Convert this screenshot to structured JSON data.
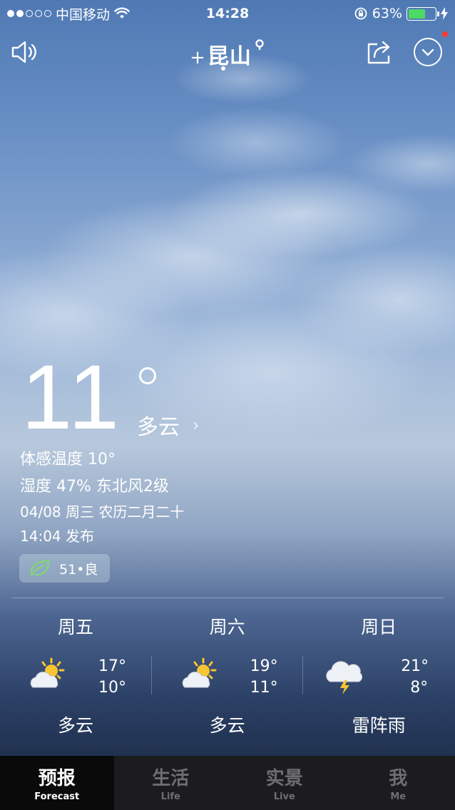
{
  "status_bar": {
    "carrier": "中国移动",
    "time": "14:28",
    "battery_percent": "63%",
    "battery_level": 0.63,
    "signal_bars_filled": 2,
    "signal_bars_total": 5
  },
  "nav": {
    "city": "昆山",
    "add_symbol": "+"
  },
  "current": {
    "temperature": "11",
    "condition": "多云",
    "feels_like": "体感温度 10°",
    "humidity_wind": "湿度 47% 东北风2级",
    "date_line": "04/08 周三 农历二月二十",
    "published": "14:04 发布",
    "aqi": "51•良"
  },
  "forecast": [
    {
      "day": "周五",
      "high": "17°",
      "low": "10°",
      "condition": "多云",
      "icon": "partly-cloudy-icon"
    },
    {
      "day": "周六",
      "high": "19°",
      "low": "11°",
      "condition": "多云",
      "icon": "partly-cloudy-icon"
    },
    {
      "day": "周日",
      "high": "21°",
      "low": "8°",
      "condition": "雷阵雨",
      "icon": "thunderstorm-icon"
    }
  ],
  "tabs": [
    {
      "cn": "预报",
      "en": "Forecast",
      "active": true
    },
    {
      "cn": "生活",
      "en": "Life",
      "active": false
    },
    {
      "cn": "实景",
      "en": "Live",
      "active": false
    },
    {
      "cn": "我",
      "en": "Me",
      "active": false
    }
  ],
  "colors": {
    "battery_fill": "#4cd964",
    "notification_dot": "#ff3b30",
    "sun": "#f7c531",
    "aqi_leaf": "#7ed67a"
  }
}
